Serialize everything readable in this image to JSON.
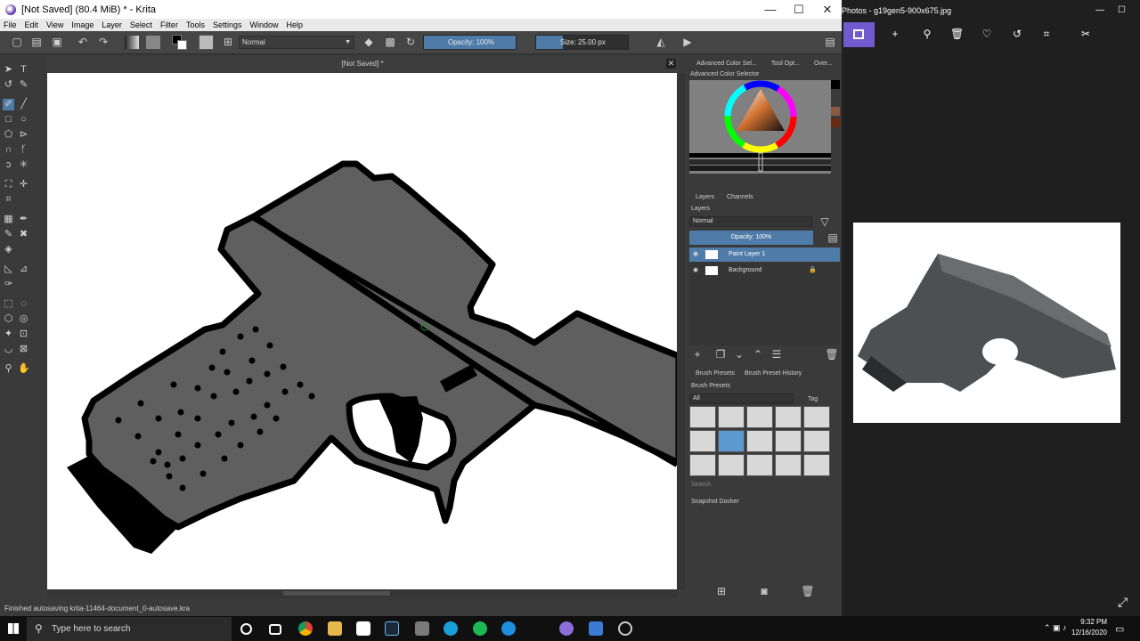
{
  "krita": {
    "title": "[Not Saved]  (80.4 MiB)  * - Krita",
    "window_buttons": [
      "—",
      "☐",
      "✕"
    ],
    "menu": [
      "File",
      "Edit",
      "View",
      "Image",
      "Layer",
      "Select",
      "Filter",
      "Tools",
      "Settings",
      "Window",
      "Help"
    ],
    "toolbar": {
      "blend_mode": "Normal",
      "opacity": "Opacity: 100%",
      "size": "Size: 25.00 px",
      "opacity_level": 1.0,
      "size_level": 0.29
    },
    "canvas_tab": "[Not Saved]  *",
    "status": "Finished autosaving krita-11464-document_0-autosave.kra",
    "dock_tabs": [
      "Advanced Color Sel...",
      "Tool Opt...",
      "Over..."
    ],
    "color_selector_title": "Advanced Color Selector",
    "layers": {
      "tabs": [
        "Layers",
        "Channels"
      ],
      "title": "Layers",
      "blend": "Normal",
      "opacity": "Opacity: 100%",
      "items": [
        {
          "name": "Paint Layer 1",
          "selected": true
        },
        {
          "name": "Background",
          "selected": false
        }
      ]
    },
    "brush": {
      "tabs": [
        "Brush Presets",
        "Brush Preset History"
      ],
      "title": "Brush Presets",
      "filter": "All",
      "tag": "Tag",
      "search_placeholder": "Search"
    },
    "snapshot_title": "Snapshot Docker"
  },
  "photos": {
    "title": "Photos - g19gen5-900x675.jpg"
  },
  "taskbar": {
    "search_placeholder": "Type here to search",
    "time": "9:32 PM",
    "date": "12/16/2020"
  },
  "colors": {
    "selected_layer": "#4f7ba8",
    "photos_accent": "#6f5ad0",
    "gun_fill": "#5f5f5f"
  }
}
